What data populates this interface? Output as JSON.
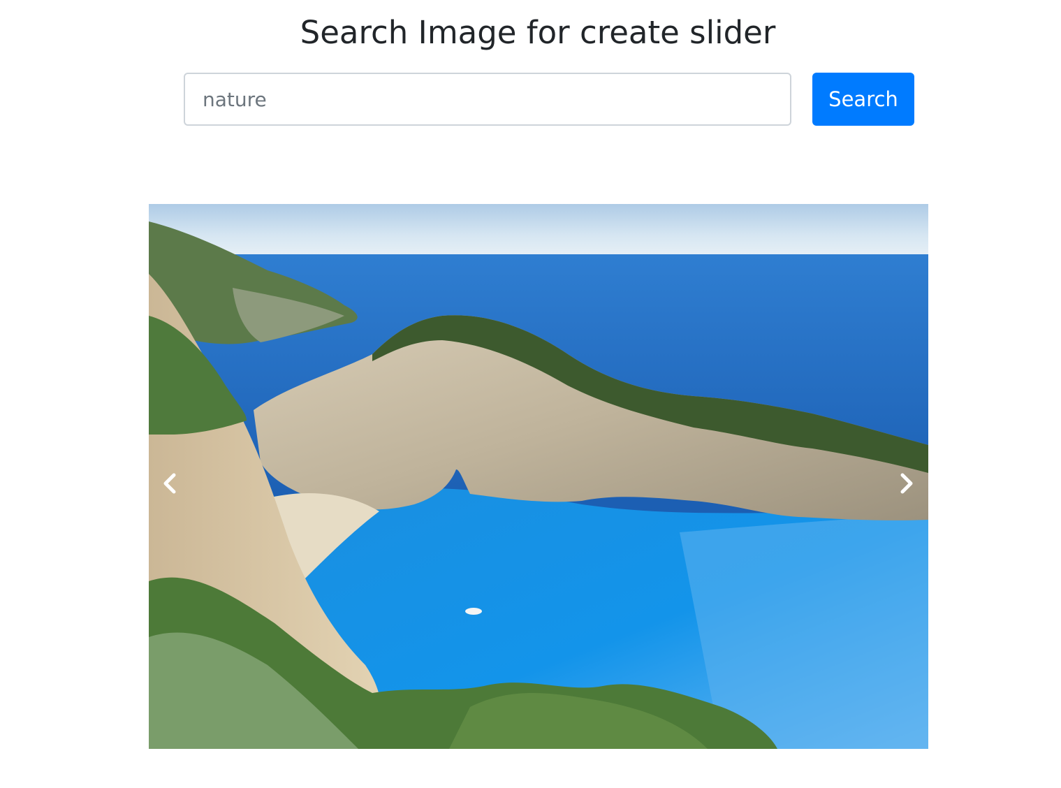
{
  "page": {
    "title": "Search Image for create slider"
  },
  "search": {
    "value": "nature",
    "button_label": "Search"
  },
  "carousel": {
    "prev_icon": "chevron-left-icon",
    "next_icon": "chevron-right-icon"
  },
  "colors": {
    "primary": "#007bff",
    "text": "#212529",
    "input_border": "#ced4da",
    "input_text": "#6c757d"
  }
}
